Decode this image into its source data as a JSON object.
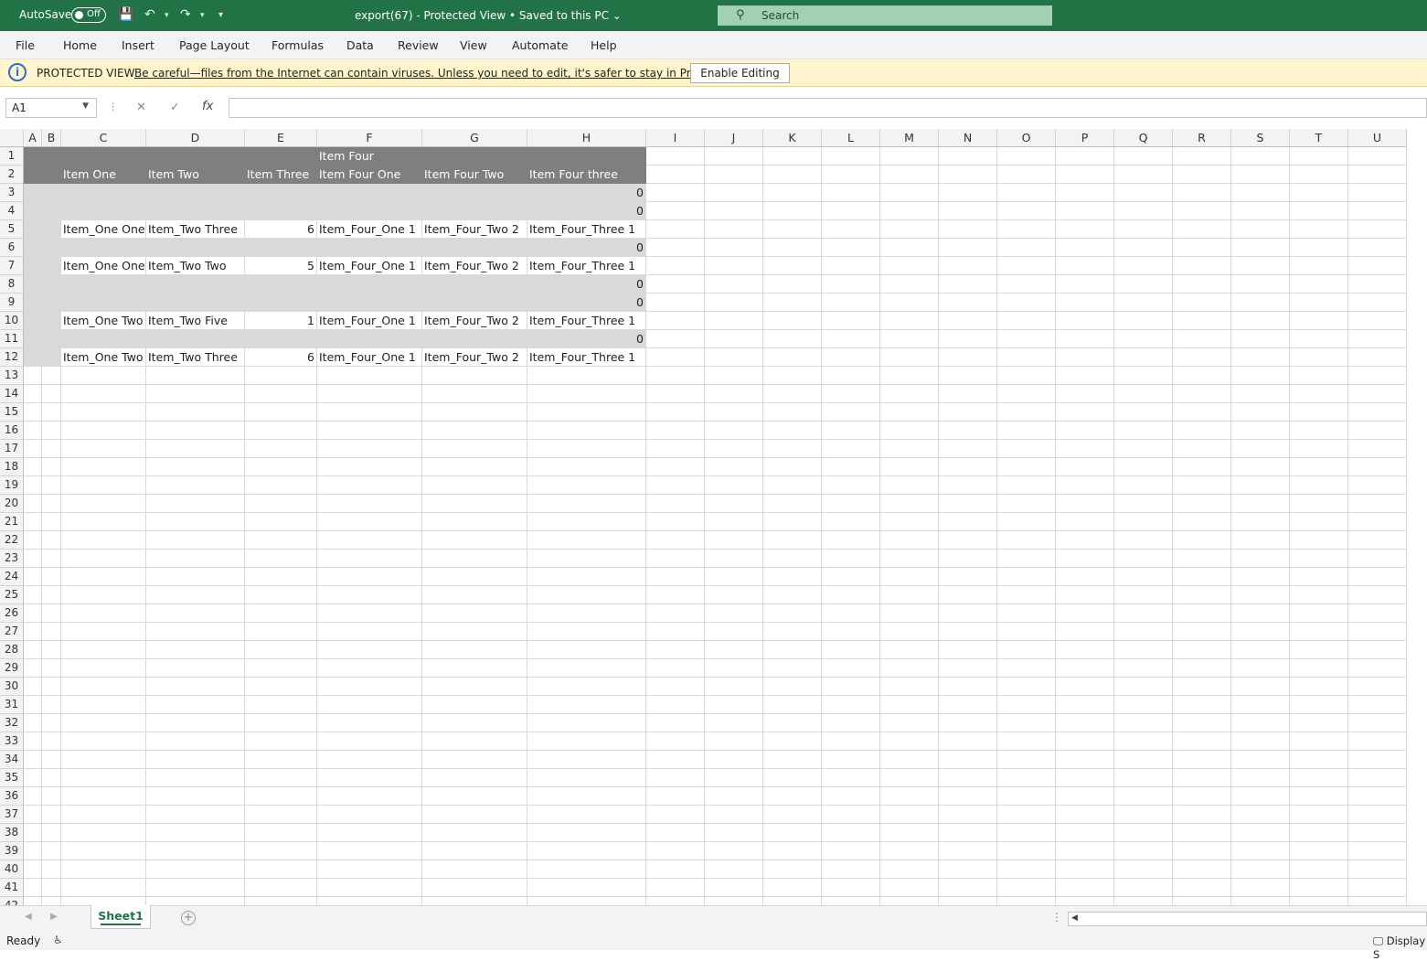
{
  "titlebar": {
    "autosave_label": "AutoSave",
    "autosave_state": "Off",
    "title": "export(67)  -  Protected View  •  Saved to this PC",
    "search_placeholder": "Search"
  },
  "menu": [
    "File",
    "Home",
    "Insert",
    "Page Layout",
    "Formulas",
    "Data",
    "Review",
    "View",
    "Automate",
    "Help"
  ],
  "protected_view": {
    "label": "PROTECTED VIEW",
    "message": "Be careful—files from the Internet can contain viruses. Unless you need to edit, it's safer to stay in Protected View.",
    "button": "Enable Editing"
  },
  "formula_bar": {
    "name_box": "A1",
    "formula": ""
  },
  "columns": [
    "A",
    "B",
    "C",
    "D",
    "E",
    "F",
    "G",
    "H",
    "I",
    "J",
    "K",
    "L",
    "M",
    "N",
    "O",
    "P",
    "Q",
    "R",
    "S",
    "T",
    "U"
  ],
  "header_rows": {
    "row1": {
      "F": "Item Four"
    },
    "row2": {
      "C": "Item One",
      "D": "Item Two",
      "E": "Item Three",
      "F": "Item Four One",
      "G": "Item Four Two",
      "H": "Item Four three"
    }
  },
  "data_rows": [
    {
      "row": 3,
      "H": "0"
    },
    {
      "row": 4,
      "H": "0"
    },
    {
      "row": 5,
      "C": "Item_One One",
      "D": "Item_Two Three",
      "E": "6",
      "F": "Item_Four_One 1",
      "G": "Item_Four_Two 2",
      "H": "Item_Four_Three 1"
    },
    {
      "row": 6,
      "H": "0"
    },
    {
      "row": 7,
      "C": "Item_One One",
      "D": "Item_Two Two",
      "E": "5",
      "F": "Item_Four_One 1",
      "G": "Item_Four_Two 2",
      "H": "Item_Four_Three 1"
    },
    {
      "row": 8,
      "H": "0"
    },
    {
      "row": 9,
      "H": "0"
    },
    {
      "row": 10,
      "C": "Item_One Two",
      "D": "Item_Two Five",
      "E": "1",
      "F": "Item_Four_One 1",
      "G": "Item_Four_Two 2",
      "H": "Item_Four_Three 1"
    },
    {
      "row": 11,
      "H": "0"
    },
    {
      "row": 12,
      "C": "Item_One Two",
      "D": "Item_Two Three",
      "E": "6",
      "F": "Item_Four_One 1",
      "G": "Item_Four_Two 2",
      "H": "Item_Four_Three 1"
    }
  ],
  "row_count": 41,
  "sheet_tab": "Sheet1",
  "status": {
    "ready": "Ready",
    "display": "Display S"
  },
  "colors": {
    "excel_green": "#217346",
    "header_fill": "#7f7f7f",
    "band_fill": "#d9d9d9",
    "warning_bar": "#fff4cc"
  }
}
